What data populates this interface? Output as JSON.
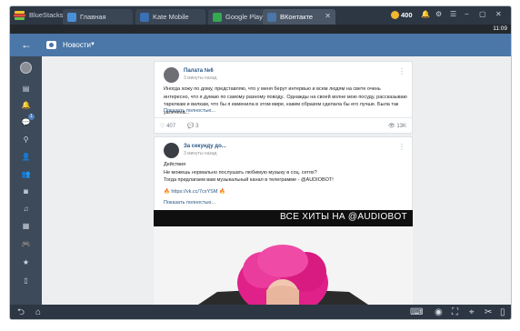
{
  "app": {
    "name": "BlueStacks",
    "tabs": [
      {
        "label": "Главная",
        "icon": "home-icon",
        "icon_color": "#4a90d9",
        "active": false
      },
      {
        "label": "Kate Mobile",
        "icon": "kate-mobile-icon",
        "icon_color": "#3b70b5",
        "active": false
      },
      {
        "label": "Google Play",
        "icon": "google-play-icon",
        "icon_color": "#34a853",
        "active": false
      },
      {
        "label": "ВКонтакте",
        "icon": "vk-icon",
        "icon_color": "#4a76a8",
        "active": true
      }
    ],
    "coins": "400"
  },
  "status": {
    "time": "11:09"
  },
  "toolbar": {
    "back_icon": "arrow-left-icon",
    "camera_icon": "camera-icon",
    "title": "Новости",
    "dropdown_icon": "chevron-down-icon"
  },
  "sidebar": {
    "items": [
      {
        "icon": "profile-avatar-icon",
        "glyph": ""
      },
      {
        "icon": "news-icon",
        "glyph": "▤"
      },
      {
        "icon": "notifications-icon",
        "glyph": "🔔"
      },
      {
        "icon": "messages-icon",
        "glyph": "💬",
        "badge": "1"
      },
      {
        "icon": "search-icon",
        "glyph": "⚲"
      },
      {
        "icon": "friends-icon",
        "glyph": "👤"
      },
      {
        "icon": "groups-icon",
        "glyph": "👥"
      },
      {
        "icon": "photos-icon",
        "glyph": "◙"
      },
      {
        "icon": "music-icon",
        "glyph": "♫"
      },
      {
        "icon": "videos-icon",
        "glyph": "▦"
      },
      {
        "icon": "games-icon",
        "glyph": "🎮"
      },
      {
        "icon": "favorites-icon",
        "glyph": "★"
      },
      {
        "icon": "documents-icon",
        "glyph": "▯"
      }
    ]
  },
  "posts": [
    {
      "author": "Палата №6",
      "time": "3 минуты назад",
      "text": "Иногда хожу по дому, представляю, что у меня берут интервью и всем людям на свете очень интересно, что я думаю по самому разному поводу.. Однажды на своей волне мою посуду, рассказываю тарелкам и вилкам, что бы я изменила в этом мире, каким образом сделала бы его лучше. Была так увлечена...",
      "more": "Показать полностью...",
      "likes": "407",
      "comments": "3",
      "views": "13K"
    },
    {
      "author": "За секунду до...",
      "time": "3 минуты назад",
      "lines": [
        "Действия",
        "Не можешь нормально послушать любимую музыку в соц. сетях?",
        "Тогда предлагаем вам музыкальный канал в телеграмме - @AUDIOBOT!"
      ],
      "link": "🔥 https://vk.cc/7cxYSM 🔥",
      "more": "Показать полностью...",
      "video_title": "ВСЕ ХИТЫ НА @AUDIOBOT"
    }
  ],
  "colors": {
    "vk_blue": "#4a76a8",
    "link": "#2a5885",
    "hat_pink": "#e0218a"
  }
}
